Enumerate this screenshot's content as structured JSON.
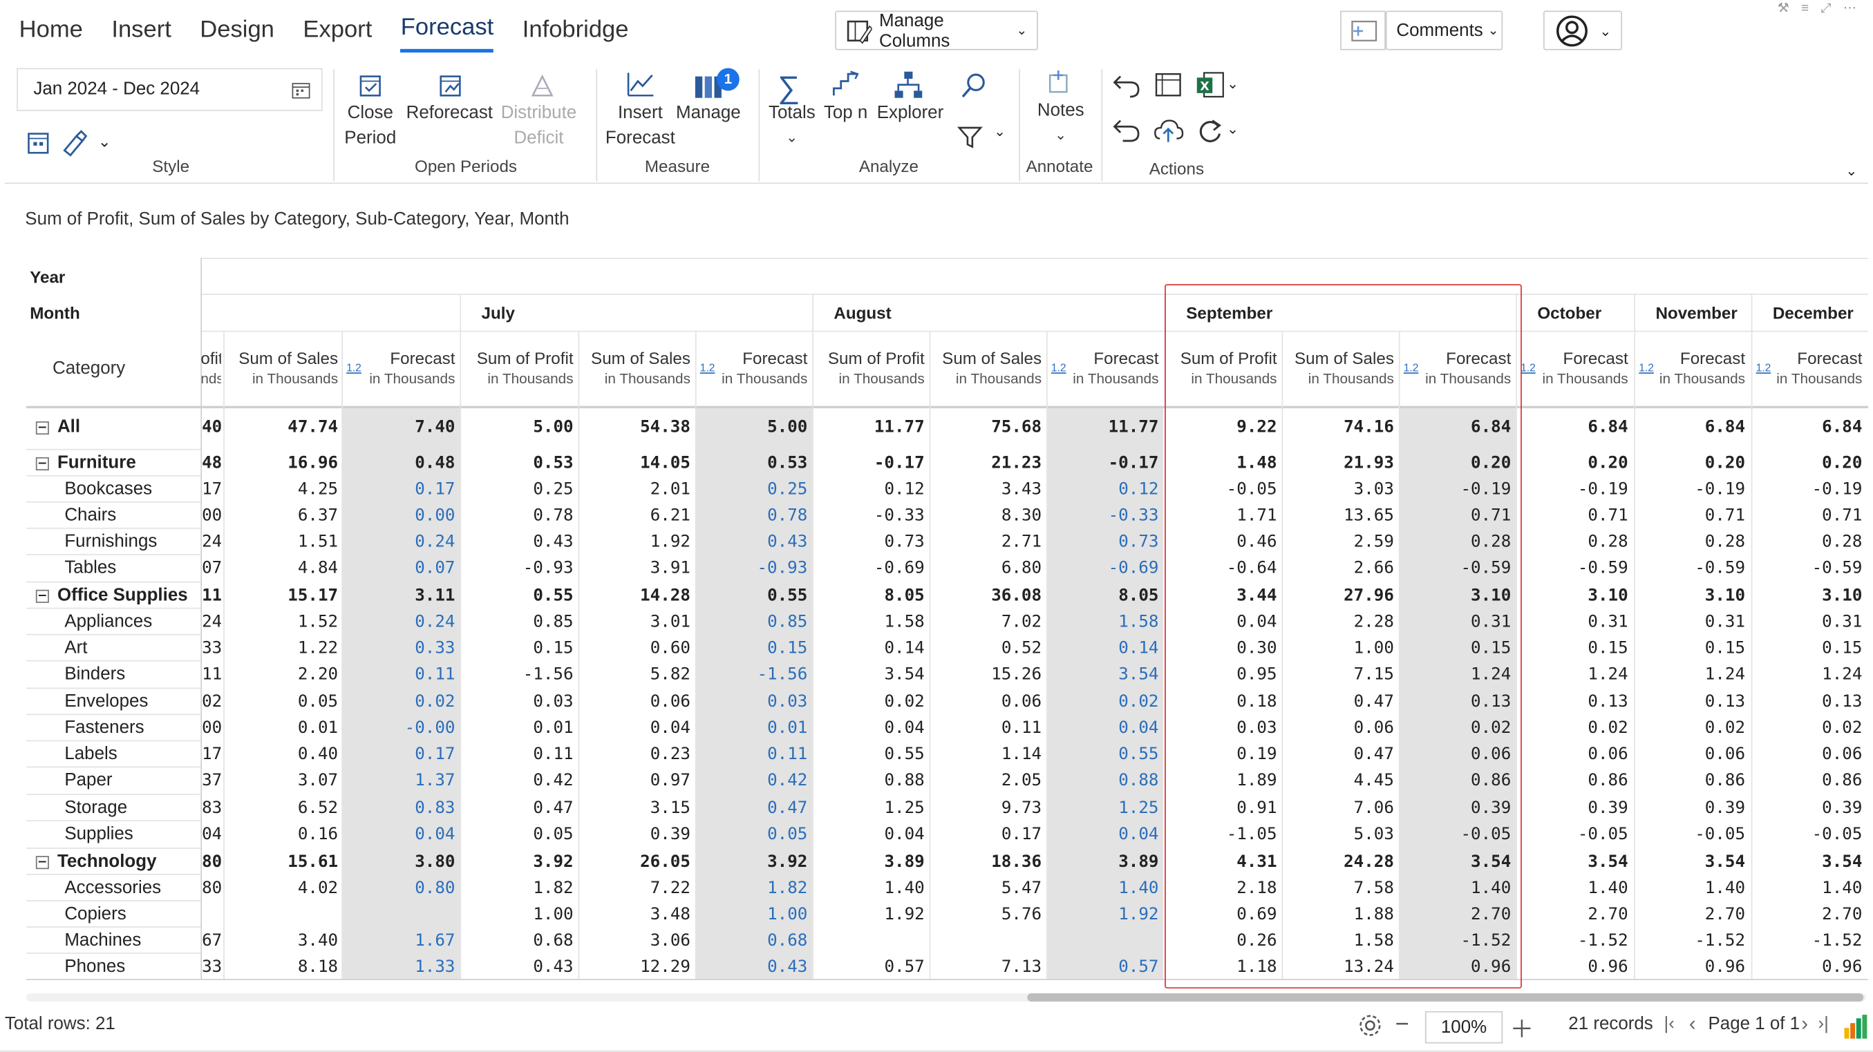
{
  "tabs": [
    "Home",
    "Insert",
    "Design",
    "Export",
    "Forecast",
    "Infobridge"
  ],
  "active_tab": "Forecast",
  "manage_columns_label": "Manage Columns",
  "comments_label": "Comments",
  "date_range": "Jan 2024 - Dec 2024",
  "ribbon": {
    "groups": [
      "Style",
      "Open Periods",
      "Measure",
      "Analyze",
      "Annotate",
      "Actions"
    ],
    "close_period": [
      "Close",
      "Period"
    ],
    "reforecast": "Reforecast",
    "distribute": [
      "Distribute",
      "Deficit"
    ],
    "insert_forecast": [
      "Insert",
      "Forecast"
    ],
    "manage": "Manage",
    "manage_badge": "1",
    "totals": "Totals",
    "topn": "Top n",
    "explorer": "Explorer",
    "notes": "Notes"
  },
  "subtitle": "Sum of Profit, Sum of Sales by Category, Sub-Category, Year, Month",
  "row_headers": {
    "year": "Year",
    "month": "Month",
    "category": "Category"
  },
  "months": [
    "July",
    "August",
    "September",
    "October",
    "November",
    "December"
  ],
  "col_labels": {
    "profit": "Sum of Profit",
    "sales": "Sum of Sales",
    "forecast": "Forecast",
    "unit": "in Thousands",
    "tag": "1.2",
    "partial_profit": "ofit",
    "partial_unit": "nds"
  },
  "rows": [
    {
      "label": "All",
      "type": "group",
      "cells": [
        "40",
        "47.74",
        "7.40",
        "5.00",
        "54.38",
        "5.00",
        "11.77",
        "75.68",
        "11.77",
        "9.22",
        "74.16",
        "6.84",
        "6.84",
        "6.84",
        "6.84"
      ]
    },
    {
      "label": "Furniture",
      "type": "group",
      "cells": [
        "48",
        "16.96",
        "0.48",
        "0.53",
        "14.05",
        "0.53",
        "-0.17",
        "21.23",
        "-0.17",
        "1.48",
        "21.93",
        "0.20",
        "0.20",
        "0.20",
        "0.20"
      ]
    },
    {
      "label": "Bookcases",
      "type": "child",
      "cells": [
        "17",
        "4.25",
        "0.17",
        "0.25",
        "2.01",
        "0.25",
        "0.12",
        "3.43",
        "0.12",
        "-0.05",
        "3.03",
        "-0.19",
        "-0.19",
        "-0.19",
        "-0.19"
      ]
    },
    {
      "label": "Chairs",
      "type": "child",
      "cells": [
        "00",
        "6.37",
        "0.00",
        "0.78",
        "6.21",
        "0.78",
        "-0.33",
        "8.30",
        "-0.33",
        "1.71",
        "13.65",
        "0.71",
        "0.71",
        "0.71",
        "0.71"
      ]
    },
    {
      "label": "Furnishings",
      "type": "child",
      "cells": [
        "24",
        "1.51",
        "0.24",
        "0.43",
        "1.92",
        "0.43",
        "0.73",
        "2.71",
        "0.73",
        "0.46",
        "2.59",
        "0.28",
        "0.28",
        "0.28",
        "0.28"
      ]
    },
    {
      "label": "Tables",
      "type": "child",
      "cells": [
        "07",
        "4.84",
        "0.07",
        "-0.93",
        "3.91",
        "-0.93",
        "-0.69",
        "6.80",
        "-0.69",
        "-0.64",
        "2.66",
        "-0.59",
        "-0.59",
        "-0.59",
        "-0.59"
      ]
    },
    {
      "label": "Office Supplies",
      "type": "group",
      "cells": [
        "11",
        "15.17",
        "3.11",
        "0.55",
        "14.28",
        "0.55",
        "8.05",
        "36.08",
        "8.05",
        "3.44",
        "27.96",
        "3.10",
        "3.10",
        "3.10",
        "3.10"
      ]
    },
    {
      "label": "Appliances",
      "type": "child",
      "cells": [
        "24",
        "1.52",
        "0.24",
        "0.85",
        "3.01",
        "0.85",
        "1.58",
        "7.02",
        "1.58",
        "0.04",
        "2.28",
        "0.31",
        "0.31",
        "0.31",
        "0.31"
      ]
    },
    {
      "label": "Art",
      "type": "child",
      "cells": [
        "33",
        "1.22",
        "0.33",
        "0.15",
        "0.60",
        "0.15",
        "0.14",
        "0.52",
        "0.14",
        "0.30",
        "1.00",
        "0.15",
        "0.15",
        "0.15",
        "0.15"
      ]
    },
    {
      "label": "Binders",
      "type": "child",
      "cells": [
        "11",
        "2.20",
        "0.11",
        "-1.56",
        "5.82",
        "-1.56",
        "3.54",
        "15.26",
        "3.54",
        "0.95",
        "7.15",
        "1.24",
        "1.24",
        "1.24",
        "1.24"
      ]
    },
    {
      "label": "Envelopes",
      "type": "child",
      "cells": [
        "02",
        "0.05",
        "0.02",
        "0.03",
        "0.06",
        "0.03",
        "0.02",
        "0.06",
        "0.02",
        "0.18",
        "0.47",
        "0.13",
        "0.13",
        "0.13",
        "0.13"
      ]
    },
    {
      "label": "Fasteners",
      "type": "child",
      "cells": [
        "00",
        "0.01",
        "-0.00",
        "0.01",
        "0.04",
        "0.01",
        "0.04",
        "0.11",
        "0.04",
        "0.03",
        "0.06",
        "0.02",
        "0.02",
        "0.02",
        "0.02"
      ]
    },
    {
      "label": "Labels",
      "type": "child",
      "cells": [
        "17",
        "0.40",
        "0.17",
        "0.11",
        "0.23",
        "0.11",
        "0.55",
        "1.14",
        "0.55",
        "0.19",
        "0.47",
        "0.06",
        "0.06",
        "0.06",
        "0.06"
      ]
    },
    {
      "label": "Paper",
      "type": "child",
      "cells": [
        "37",
        "3.07",
        "1.37",
        "0.42",
        "0.97",
        "0.42",
        "0.88",
        "2.05",
        "0.88",
        "1.89",
        "4.45",
        "0.86",
        "0.86",
        "0.86",
        "0.86"
      ]
    },
    {
      "label": "Storage",
      "type": "child",
      "cells": [
        "83",
        "6.52",
        "0.83",
        "0.47",
        "3.15",
        "0.47",
        "1.25",
        "9.73",
        "1.25",
        "0.91",
        "7.06",
        "0.39",
        "0.39",
        "0.39",
        "0.39"
      ]
    },
    {
      "label": "Supplies",
      "type": "child",
      "cells": [
        "04",
        "0.16",
        "0.04",
        "0.05",
        "0.39",
        "0.05",
        "0.04",
        "0.17",
        "0.04",
        "-1.05",
        "5.03",
        "-0.05",
        "-0.05",
        "-0.05",
        "-0.05"
      ]
    },
    {
      "label": "Technology",
      "type": "group",
      "cells": [
        "80",
        "15.61",
        "3.80",
        "3.92",
        "26.05",
        "3.92",
        "3.89",
        "18.36",
        "3.89",
        "4.31",
        "24.28",
        "3.54",
        "3.54",
        "3.54",
        "3.54"
      ]
    },
    {
      "label": "Accessories",
      "type": "child",
      "cells": [
        "80",
        "4.02",
        "0.80",
        "1.82",
        "7.22",
        "1.82",
        "1.40",
        "5.47",
        "1.40",
        "2.18",
        "7.58",
        "1.40",
        "1.40",
        "1.40",
        "1.40"
      ]
    },
    {
      "label": "Copiers",
      "type": "child",
      "cells": [
        "",
        "",
        "",
        "1.00",
        "3.48",
        "1.00",
        "1.92",
        "5.76",
        "1.92",
        "0.69",
        "1.88",
        "2.70",
        "2.70",
        "2.70",
        "2.70"
      ]
    },
    {
      "label": "Machines",
      "type": "child",
      "cells": [
        "67",
        "3.40",
        "1.67",
        "0.68",
        "3.06",
        "0.68",
        "",
        "",
        "",
        "0.26",
        "1.58",
        "-1.52",
        "-1.52",
        "-1.52",
        "-1.52"
      ]
    },
    {
      "label": "Phones",
      "type": "child",
      "cells": [
        "33",
        "8.18",
        "1.33",
        "0.43",
        "12.29",
        "0.43",
        "0.57",
        "7.13",
        "0.57",
        "1.18",
        "13.24",
        "0.96",
        "0.96",
        "0.96",
        "0.96"
      ]
    }
  ],
  "status": {
    "total_rows": "Total rows: 21",
    "zoom": "100%",
    "records": "21 records",
    "page": "Page 1 of 1"
  },
  "colors": {
    "accent": "#1a73e8",
    "highlight_box": "#e03030",
    "forecast_blue": "#2a6ebb",
    "forecast_shade": "#e3e3e3"
  }
}
